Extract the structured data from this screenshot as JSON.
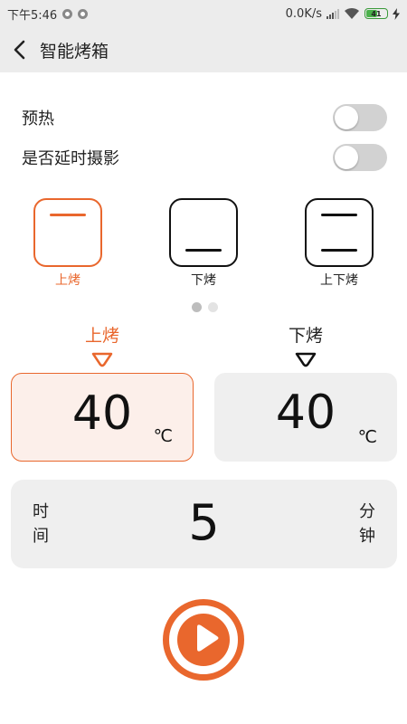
{
  "status_bar": {
    "time": "下午5:46",
    "network_speed": "0.0K/s",
    "battery": "41"
  },
  "header": {
    "title": "智能烤箱"
  },
  "settings": {
    "preheat_label": "预热",
    "preheat_on": false,
    "timelapse_label": "是否延时摄影",
    "timelapse_on": false
  },
  "modes": {
    "items": [
      {
        "label": "上烤",
        "icon": "top-heat-icon",
        "active": true
      },
      {
        "label": "下烤",
        "icon": "bottom-heat-icon",
        "active": false
      },
      {
        "label": "上下烤",
        "icon": "top-bottom-heat-icon",
        "active": false
      }
    ],
    "page_count": 2,
    "current_page": 1
  },
  "temperature": {
    "top": {
      "label": "上烤",
      "value": "40",
      "unit": "℃"
    },
    "bottom": {
      "label": "下烤",
      "value": "40",
      "unit": "℃"
    }
  },
  "time": {
    "label_line1": "时",
    "label_line2": "间",
    "value": "5",
    "unit_line1": "分",
    "unit_line2": "钟"
  },
  "colors": {
    "accent": "#e9672d",
    "toggle_off": "#d2d2d2",
    "panel_bg": "#efefef"
  }
}
